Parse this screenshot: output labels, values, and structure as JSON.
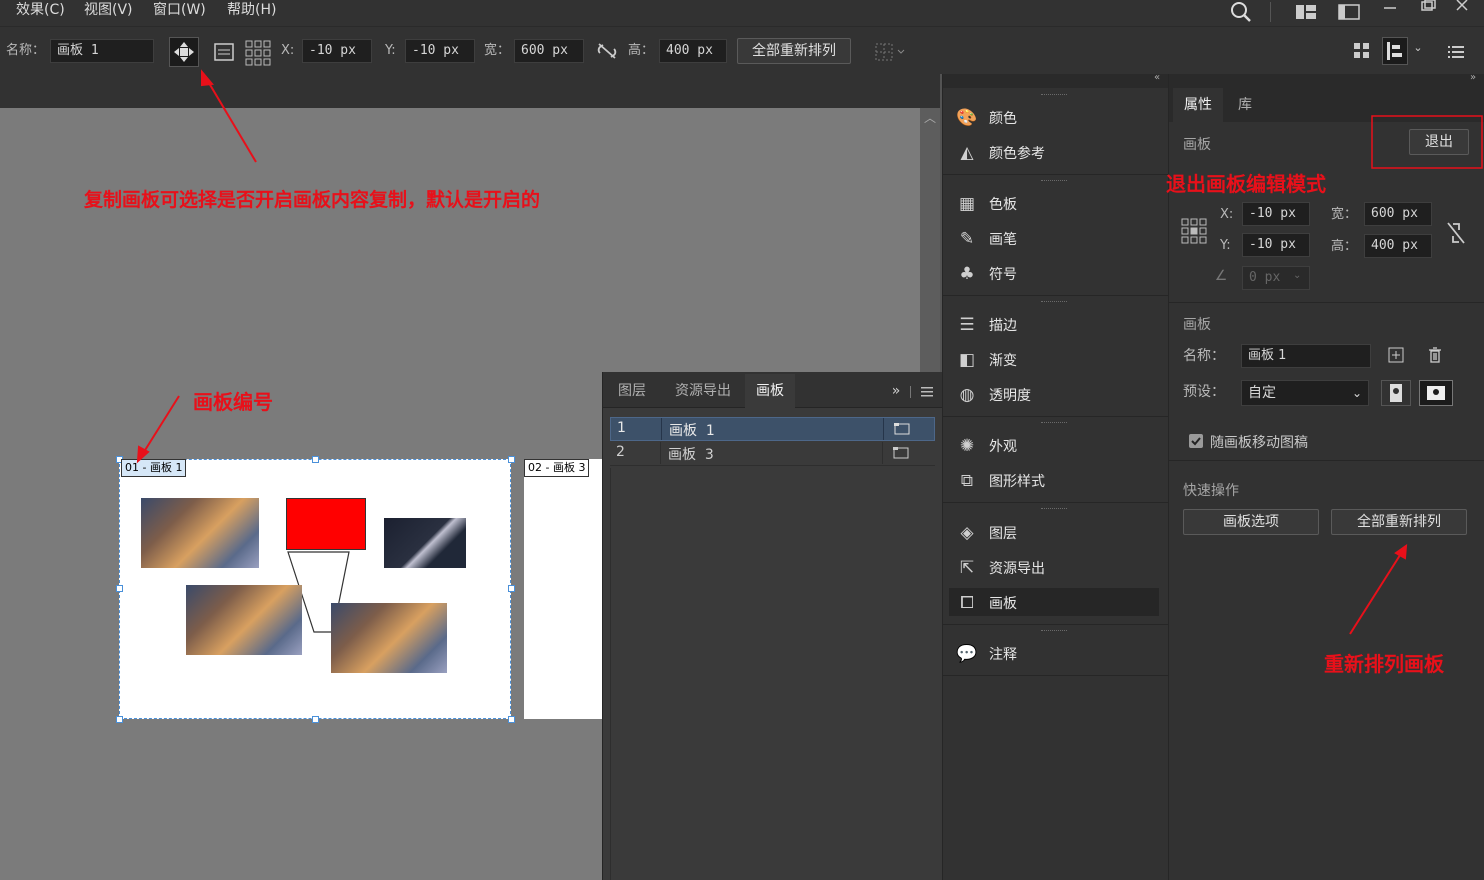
{
  "menu": {
    "effects": "效果(C)",
    "view": "视图(V)",
    "window": "窗口(W)",
    "help": "帮助(H)"
  },
  "control": {
    "name_label": "名称：",
    "name_value": "画板 1",
    "x_label": "X:",
    "x_value": "-10 px",
    "y_label": "Y:",
    "y_value": "-10 px",
    "w_label": "宽：",
    "w_value": "600 px",
    "h_label": "高：",
    "h_value": "400 px",
    "rearrange_all": "全部重新排列"
  },
  "artboards": {
    "label1": "01 - 画板 1",
    "label2": "02 - 画板 3"
  },
  "floating_panel": {
    "tabs": [
      "图层",
      "资源导出",
      "画板"
    ],
    "rows": [
      {
        "num": "1",
        "name": "画板  1"
      },
      {
        "num": "2",
        "name": "画板  3"
      }
    ]
  },
  "dock": {
    "items": [
      "颜色",
      "颜色参考",
      "色板",
      "画笔",
      "符号",
      "描边",
      "渐变",
      "透明度",
      "外观",
      "图形样式",
      "图层",
      "资源导出",
      "画板",
      "注释"
    ]
  },
  "properties": {
    "tab_properties": "属性",
    "tab_library": "库",
    "section_artboard": "画板",
    "exit": "退出",
    "x_label": "X:",
    "x_value": "-10 px",
    "y_label": "Y:",
    "y_value": "-10 px",
    "w_label": "宽：",
    "w_value": "600 px",
    "h_label": "高：",
    "h_value": "400 px",
    "angle_value": "0 px",
    "artboard_section2": "画板",
    "name_label": "名称：",
    "name_value": "画板 1",
    "preset_label": "预设：",
    "preset_value": "自定",
    "move_with_artboard": "随画板移动图稿",
    "quick_actions": "快速操作",
    "artboard_options": "画板选项",
    "rearrange_all": "全部重新排列"
  },
  "annotations": {
    "copy_artboard": "复制画板可选择是否开启画板内容复制，默认是开启的",
    "artboard_number": "画板编号",
    "exit_edit_mode": "退出画板编辑模式",
    "rearrange": "重新排列画板"
  },
  "colors": {
    "annotation": "#e8101a",
    "red_rect": "#ff0000",
    "selected_row": "#3d5169",
    "active_dock": "#262626"
  }
}
